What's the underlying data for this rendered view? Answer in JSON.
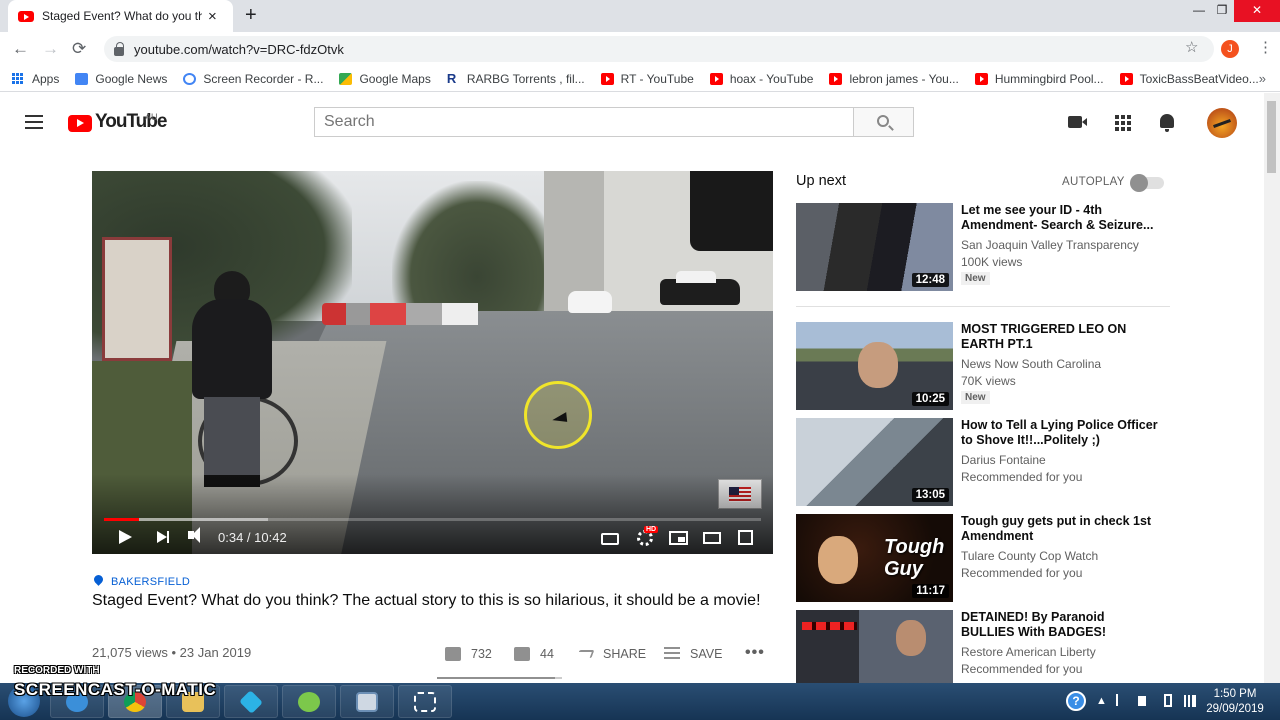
{
  "browser": {
    "tab_title": "Staged Event? What do you think",
    "tab_close": "×",
    "new_tab": "+",
    "url": "youtube.com/watch?v=DRC-fdzOtvk",
    "profile_initial": "J",
    "window_controls": {
      "minimize": "—",
      "restore": "❐",
      "close": "✕"
    },
    "nav": {
      "back": "←",
      "forward": "→",
      "reload": "⟳"
    },
    "star": "☆",
    "menu": "⋮",
    "bookmarks_more": "»",
    "bookmarks": [
      {
        "label": "Apps",
        "icon": "apps-icon"
      },
      {
        "label": "Google News",
        "icon": "google-news-icon"
      },
      {
        "label": "Screen Recorder - R...",
        "icon": "screen-recorder-icon"
      },
      {
        "label": "Google Maps",
        "icon": "google-maps-icon"
      },
      {
        "label": "RARBG Torrents , fil...",
        "icon": "rarbg-icon",
        "glyph": "R"
      },
      {
        "label": "RT - YouTube",
        "icon": "youtube-icon"
      },
      {
        "label": "hoax - YouTube",
        "icon": "youtube-icon"
      },
      {
        "label": "lebron james - You...",
        "icon": "youtube-icon"
      },
      {
        "label": "Hummingbird Pool...",
        "icon": "youtube-icon"
      },
      {
        "label": "ToxicBassBeatVideo...",
        "icon": "youtube-icon"
      }
    ]
  },
  "youtube": {
    "wordmark": "YouTube",
    "region": "AU",
    "search_placeholder": "Search"
  },
  "player": {
    "time": "0:34 / 10:42",
    "progress_played_fraction": 0.053,
    "progress_loaded_fraction": 0.25,
    "hd_badge": "HD"
  },
  "video": {
    "location": "BAKERSFIELD",
    "title": "Staged Event? What do you think? The actual story to this is so hilarious, it should be a movie!",
    "meta": "21,075 views • 23 Jan 2019",
    "likes": "732",
    "dislikes": "44",
    "share_label": "SHARE",
    "save_label": "SAVE",
    "more_label": "•••",
    "like_fraction": 0.943
  },
  "upnext": {
    "title": "Up next",
    "autoplay_label": "AUTOPLAY",
    "autoplay_on": false,
    "items": [
      {
        "title": "Let me see your ID - 4th Amendment- Search & Seizure...",
        "channel": "San Joaquin Valley Transparency",
        "views": "100K views",
        "badge": "New",
        "duration": "12:48"
      },
      {
        "title": "MOST TRIGGERED LEO ON EARTH PT.1",
        "channel": "News Now South Carolina",
        "views": "70K views",
        "badge": "New",
        "duration": "10:25"
      },
      {
        "title": "How to Tell a Lying Police Officer to Shove It!!...Politely ;)",
        "channel": "Darius Fontaine",
        "views": "Recommended for you",
        "badge": "",
        "duration": "13:05"
      },
      {
        "title": "Tough guy gets put in check 1st Amendment",
        "channel": "Tulare County Cop Watch",
        "views": "Recommended for you",
        "badge": "",
        "duration": "11:17",
        "thumb_text": "Tough Guy"
      },
      {
        "title": "DETAINED! By Paranoid BULLIES With BADGES!",
        "channel": "Restore American Liberty",
        "views": "Recommended for you",
        "badge": "",
        "duration": ""
      }
    ]
  },
  "taskbar": {
    "time": "1:50 PM",
    "date": "29/09/2019",
    "help_glyph": "?",
    "tray_arrow": "▲"
  },
  "watermark": {
    "line1": "RECORDED WITH",
    "line2": "SCREENCAST-O-MATIC"
  },
  "colors": {
    "youtube_red": "#ff0000",
    "link_blue": "#065fd4",
    "taskbar": "#1f4266"
  }
}
